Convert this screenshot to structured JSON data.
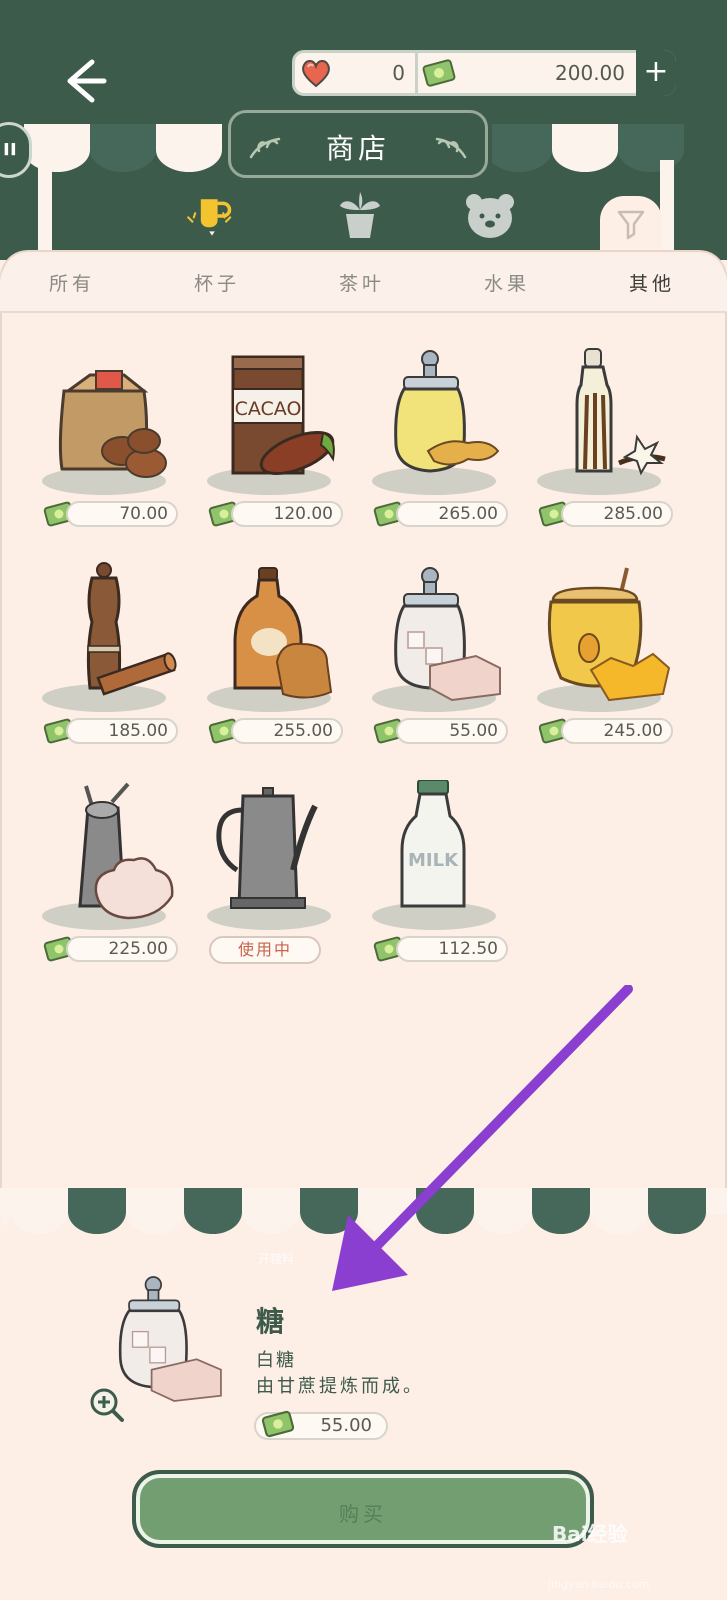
{
  "header": {
    "title": "商店",
    "hearts": "0",
    "money": "200.00",
    "add_label": "+"
  },
  "category_icons": [
    "cup-icon",
    "plant-icon",
    "bear-icon"
  ],
  "tabs": [
    {
      "label": "所有",
      "active": false
    },
    {
      "label": "杯子",
      "active": false
    },
    {
      "label": "茶叶",
      "active": false
    },
    {
      "label": "水果",
      "active": false
    },
    {
      "label": "其他",
      "active": true
    }
  ],
  "items": [
    {
      "name": "coffee-beans",
      "price": "70.00"
    },
    {
      "name": "cacao",
      "price": "120.00"
    },
    {
      "name": "ginger",
      "price": "265.00"
    },
    {
      "name": "vanilla",
      "price": "285.00"
    },
    {
      "name": "cinnamon",
      "price": "185.00"
    },
    {
      "name": "maple-syrup",
      "price": "255.00"
    },
    {
      "name": "sugar",
      "price": "55.00"
    },
    {
      "name": "honey",
      "price": "245.00"
    },
    {
      "name": "whipped-cream",
      "price": "225.00"
    },
    {
      "name": "kettle",
      "status": "使用中"
    },
    {
      "name": "milk",
      "price": "112.50",
      "label": "MILK"
    }
  ],
  "cacao_label": "CACAO",
  "detail": {
    "tag": "开糖料",
    "name": "糖",
    "subtitle": "白糖",
    "description": "由甘蔗提炼而成。",
    "price": "55.00",
    "buy_label": "购买"
  },
  "watermark": {
    "text": "Bai经验",
    "sub": "jingyan.baidu.com"
  },
  "colors": {
    "header_green": "#3d5b4b",
    "panel_bg": "#fdeee6",
    "button_green": "#739e72",
    "arrow_purple": "#8a3fd1"
  }
}
